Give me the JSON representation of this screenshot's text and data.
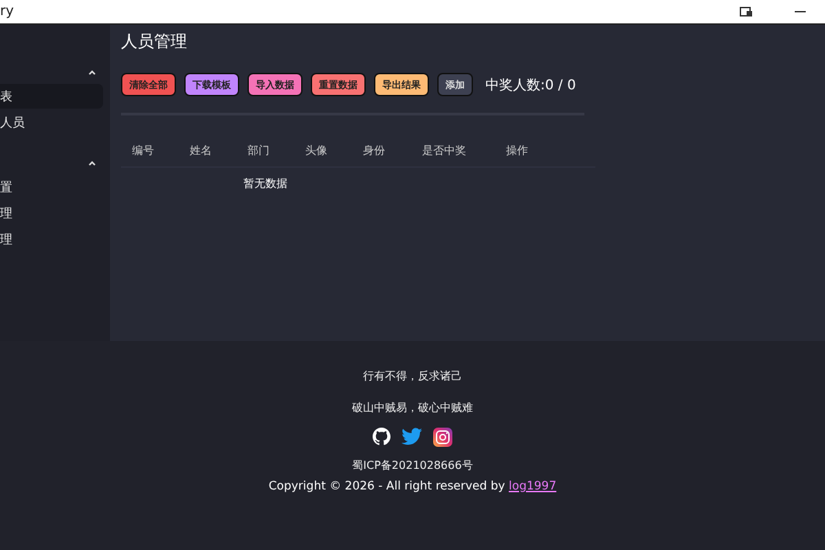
{
  "window": {
    "title": "ry"
  },
  "sidebar": {
    "groups": [
      {
        "expanded": true,
        "items": [
          {
            "label": "表",
            "selected": true
          },
          {
            "label": "人员",
            "selected": false
          }
        ]
      },
      {
        "expanded": true,
        "items": [
          {
            "label": "置",
            "selected": false
          },
          {
            "label": "理",
            "selected": false
          },
          {
            "label": "理",
            "selected": false
          }
        ]
      }
    ]
  },
  "page_title": "人员管理",
  "toolbar": {
    "buttons": [
      {
        "label": "清除全部",
        "color": "#f05252"
      },
      {
        "label": "下载模板",
        "color": "#c084fc"
      },
      {
        "label": "导入数据",
        "color": "#f472b6"
      },
      {
        "label": "重置数据",
        "color": "#f87171"
      },
      {
        "label": "导出结果",
        "color": "#fdba74"
      },
      {
        "label": "添加",
        "color": "#3d4051"
      }
    ],
    "winner_count": "中奖人数:0 / 0"
  },
  "table": {
    "columns": [
      "编号",
      "姓名",
      "部门",
      "头像",
      "身份",
      "是否中奖",
      "操作"
    ],
    "empty_text": "暂无数据"
  },
  "footer": {
    "lines": [
      "行有不得，反求诸己",
      "破山中贼易，破心中贼难"
    ],
    "icp": "蜀ICP备2021028666号",
    "copyright": "Copyright © 2026 - All right reserved by ",
    "author_link": "log1997"
  }
}
